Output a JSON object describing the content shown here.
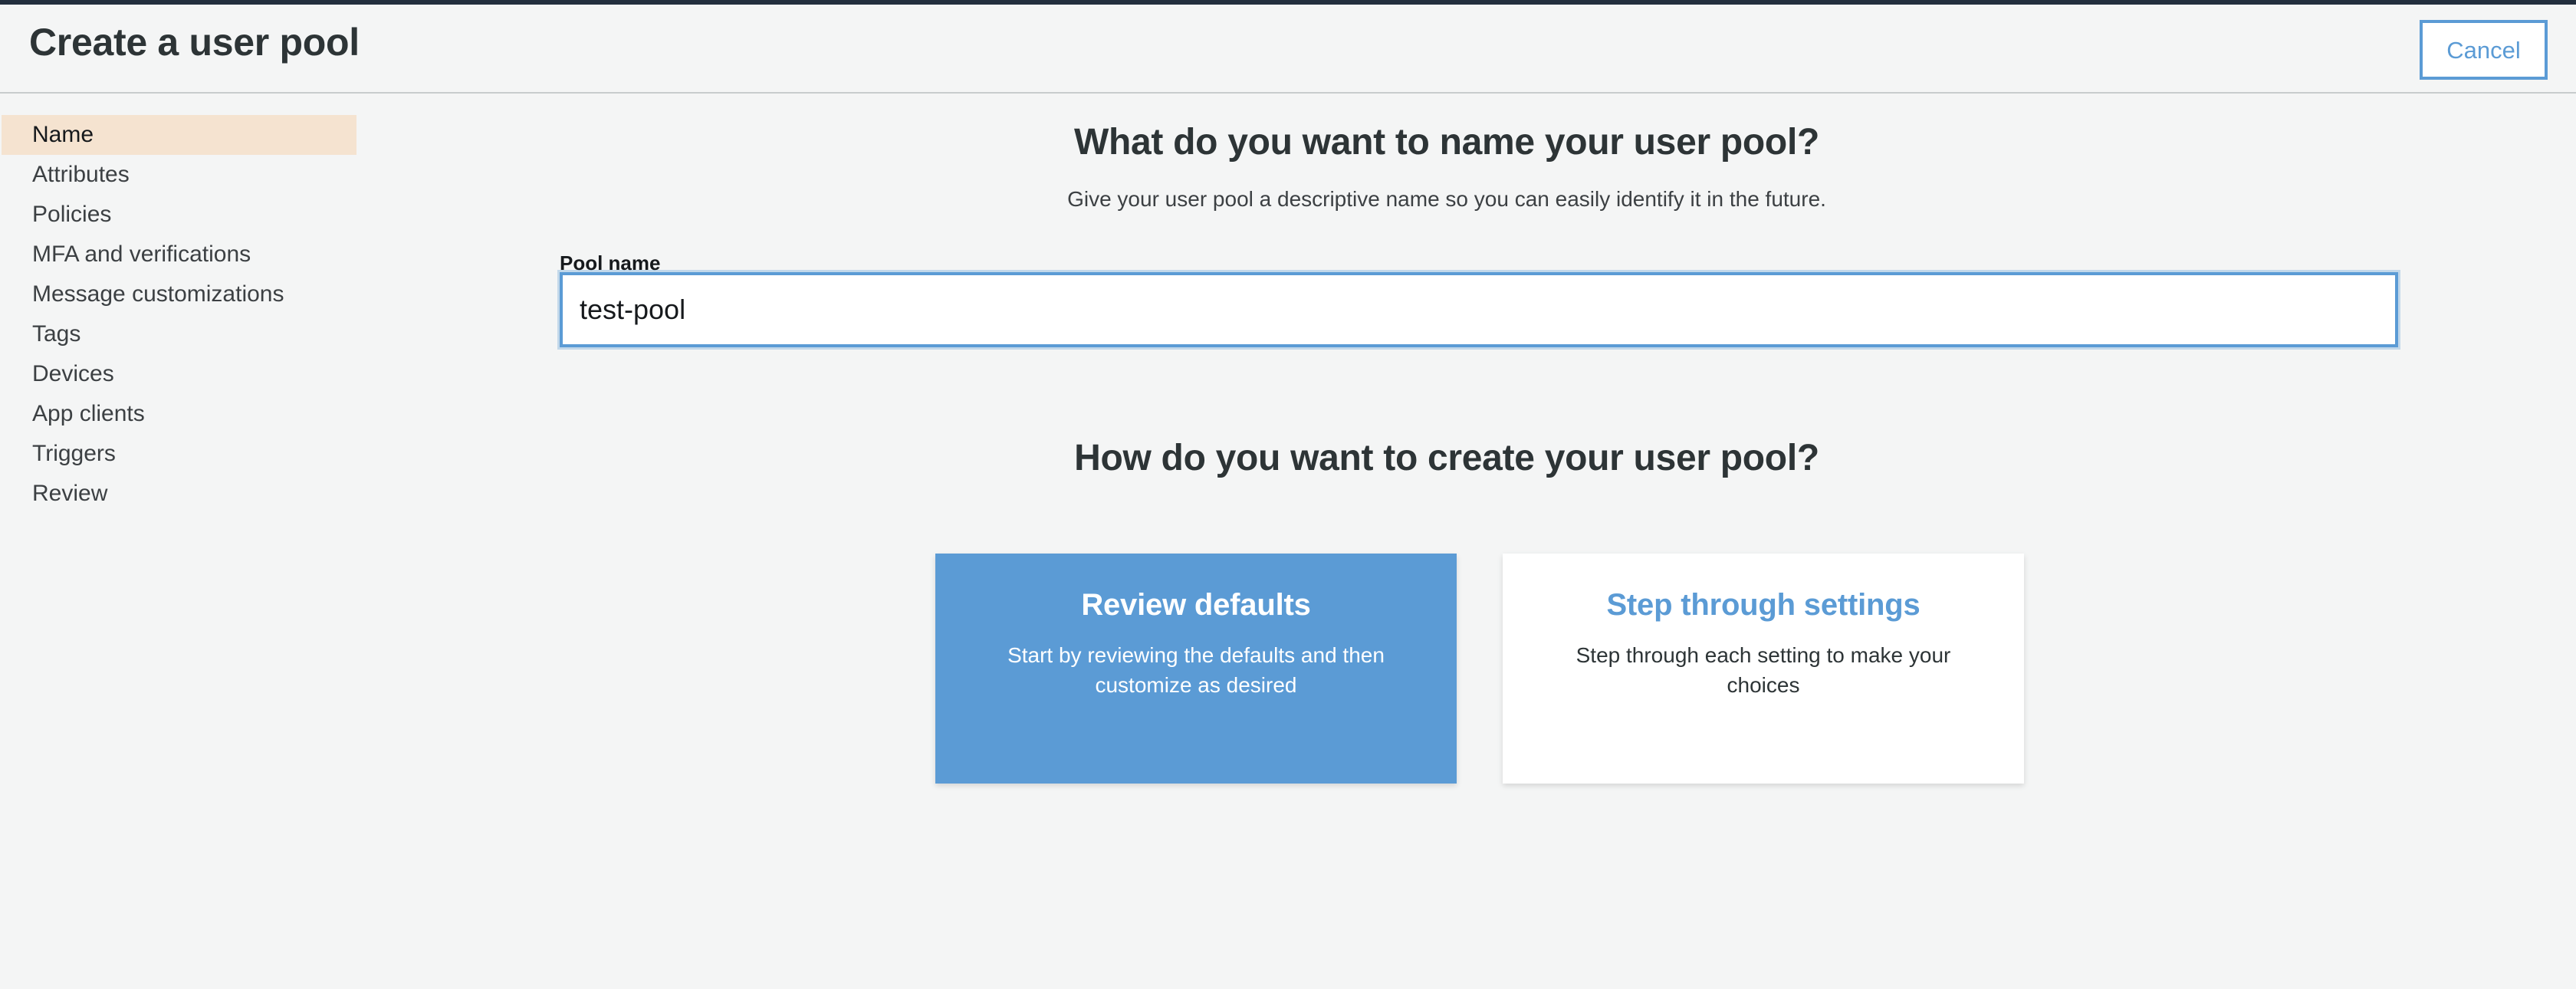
{
  "header": {
    "title": "Create a user pool",
    "cancel_label": "Cancel"
  },
  "sidebar": {
    "items": [
      {
        "label": "Name",
        "active": true
      },
      {
        "label": "Attributes",
        "active": false
      },
      {
        "label": "Policies",
        "active": false
      },
      {
        "label": "MFA and verifications",
        "active": false
      },
      {
        "label": "Message customizations",
        "active": false
      },
      {
        "label": "Tags",
        "active": false
      },
      {
        "label": "Devices",
        "active": false
      },
      {
        "label": "App clients",
        "active": false
      },
      {
        "label": "Triggers",
        "active": false
      },
      {
        "label": "Review",
        "active": false
      }
    ]
  },
  "main": {
    "name_heading": "What do you want to name your user pool?",
    "name_subtitle": "Give your user pool a descriptive name so you can easily identify it in the future.",
    "pool_name_label": "Pool name",
    "pool_name_value": "test-pool",
    "pool_name_placeholder": "",
    "create_heading": "How do you want to create your user pool?",
    "cards": [
      {
        "title": "Review defaults",
        "description": "Start by reviewing the defaults and then customize as desired",
        "style": "primary"
      },
      {
        "title": "Step through settings",
        "description": "Step through each setting to make your choices",
        "style": "secondary"
      }
    ]
  },
  "colors": {
    "accent_blue": "#5b9bd5",
    "active_highlight": "#f5e3d0",
    "page_background": "#f4f5f5",
    "top_strip": "#232f3e",
    "text_dark": "#2d3436"
  }
}
